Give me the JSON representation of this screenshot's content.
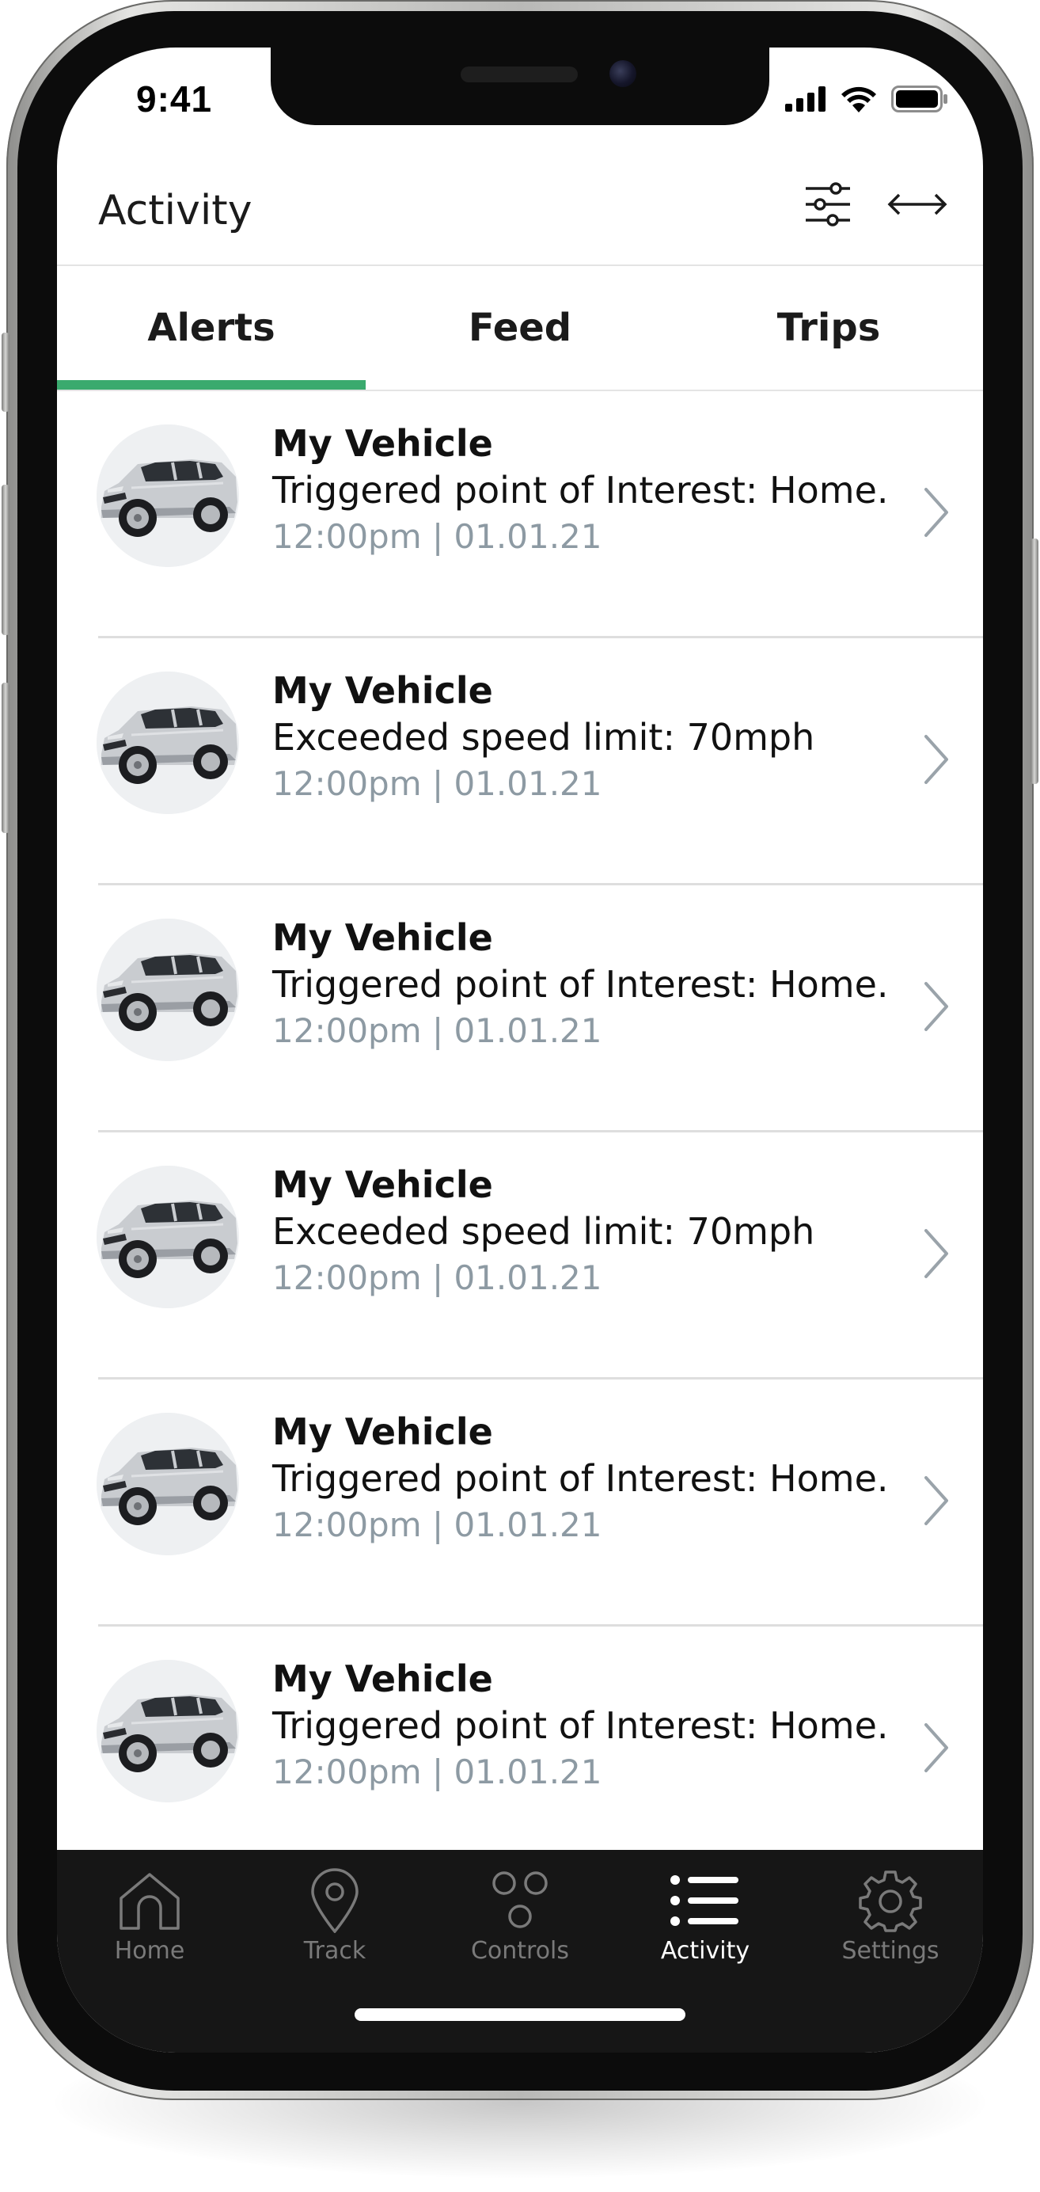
{
  "status_bar": {
    "time": "9:41",
    "icons": [
      "signal-icon",
      "wifi-icon",
      "battery-icon"
    ]
  },
  "header": {
    "title": "Activity",
    "icons": [
      "filter-sliders-icon",
      "expand-arrows-icon"
    ]
  },
  "tabs": [
    {
      "label": "Alerts",
      "active": true
    },
    {
      "label": "Feed",
      "active": false
    },
    {
      "label": "Trips",
      "active": false
    }
  ],
  "alerts": [
    {
      "vehicle": "My Vehicle",
      "message": "Triggered point of Interest: Home.",
      "timestamp": "12:00pm | 01.01.21"
    },
    {
      "vehicle": "My Vehicle",
      "message": "Exceeded speed limit: 70mph",
      "timestamp": "12:00pm | 01.01.21"
    },
    {
      "vehicle": "My Vehicle",
      "message": "Triggered point of Interest: Home.",
      "timestamp": "12:00pm | 01.01.21"
    },
    {
      "vehicle": "My Vehicle",
      "message": "Exceeded speed limit: 70mph",
      "timestamp": "12:00pm | 01.01.21"
    },
    {
      "vehicle": "My Vehicle",
      "message": "Triggered point of Interest: Home.",
      "timestamp": "12:00pm | 01.01.21"
    },
    {
      "vehicle": "My Vehicle",
      "message": "Triggered point of Interest: Home.",
      "timestamp": "12:00pm | 01.01.21"
    }
  ],
  "tabbar": [
    {
      "label": "Home",
      "icon": "home-icon",
      "active": false
    },
    {
      "label": "Track",
      "icon": "location-pin-icon",
      "active": false
    },
    {
      "label": "Controls",
      "icon": "controls-dots-icon",
      "active": false
    },
    {
      "label": "Activity",
      "icon": "list-icon",
      "active": true
    },
    {
      "label": "Settings",
      "icon": "gear-icon",
      "active": false
    }
  ],
  "colors": {
    "accent": "#3aaa6e",
    "timestamp": "#8d9aa3",
    "tabbar_bg": "#161616",
    "tabbar_inactive": "#7a7a7a",
    "tabbar_active": "#ffffff"
  }
}
